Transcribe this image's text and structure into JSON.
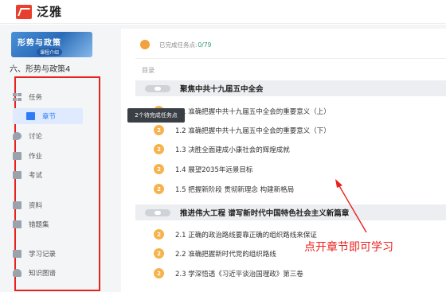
{
  "header": {
    "logo_text": "泛雅"
  },
  "course": {
    "cover_title": "形势与政策",
    "cover_badge": "课程介绍",
    "name": "六、形势与政策4"
  },
  "sidebar": {
    "items": [
      {
        "label": "任务",
        "icon": "task-grid-icon",
        "active": false
      },
      {
        "label": "章节",
        "icon": "chapter-icon",
        "active": true
      },
      {
        "label": "讨论",
        "icon": "discussion-icon",
        "active": false
      },
      {
        "label": "作业",
        "icon": "homework-icon",
        "active": false
      },
      {
        "label": "考试",
        "icon": "exam-icon",
        "active": false
      },
      {
        "label": "资料",
        "icon": "materials-icon",
        "active": false
      },
      {
        "label": "错题集",
        "icon": "wrong-questions-icon",
        "active": false
      },
      {
        "label": "学习记录",
        "icon": "study-record-icon",
        "active": false
      },
      {
        "label": "知识图谱",
        "icon": "knowledge-graph-icon",
        "active": false
      }
    ],
    "tooltip": "2个待完成任务点"
  },
  "main": {
    "progress_label": "已完成任务点: ",
    "progress_count": "0/79",
    "toc_label": "目录",
    "chapters": [
      {
        "number": "1",
        "title": "聚焦中共十九届五中全会",
        "sections": [
          {
            "badge": "2",
            "title": "1.1 准确把握中共十九届五中全会的重要意义（上）"
          },
          {
            "badge": "2",
            "title": "1.2 准确把握中共十九届五中全会的重要意义（下）"
          },
          {
            "badge": "2",
            "title": "1.3 决胜全面建成小康社会的辉煌成就"
          },
          {
            "badge": "2",
            "title": "1.4 展望2035年远景目标"
          },
          {
            "badge": "2",
            "title": "1.5 把握新阶段 贯彻新理念 构建新格局"
          }
        ]
      },
      {
        "number": "2",
        "title": "推进伟大工程 谱写新时代中国特色社会主义新篇章",
        "sections": [
          {
            "badge": "2",
            "title": "2.1 正确的政治路线要靠正确的组织路线来保证"
          },
          {
            "badge": "2",
            "title": "2.2 准确把握新时代党的组织路线"
          },
          {
            "badge": "2",
            "title": "2.3 学深悟透《习近平谈治国理政》第三卷"
          }
        ]
      }
    ]
  },
  "annotation": {
    "text": "点开章节即可学习",
    "color": "#e8231e"
  }
}
